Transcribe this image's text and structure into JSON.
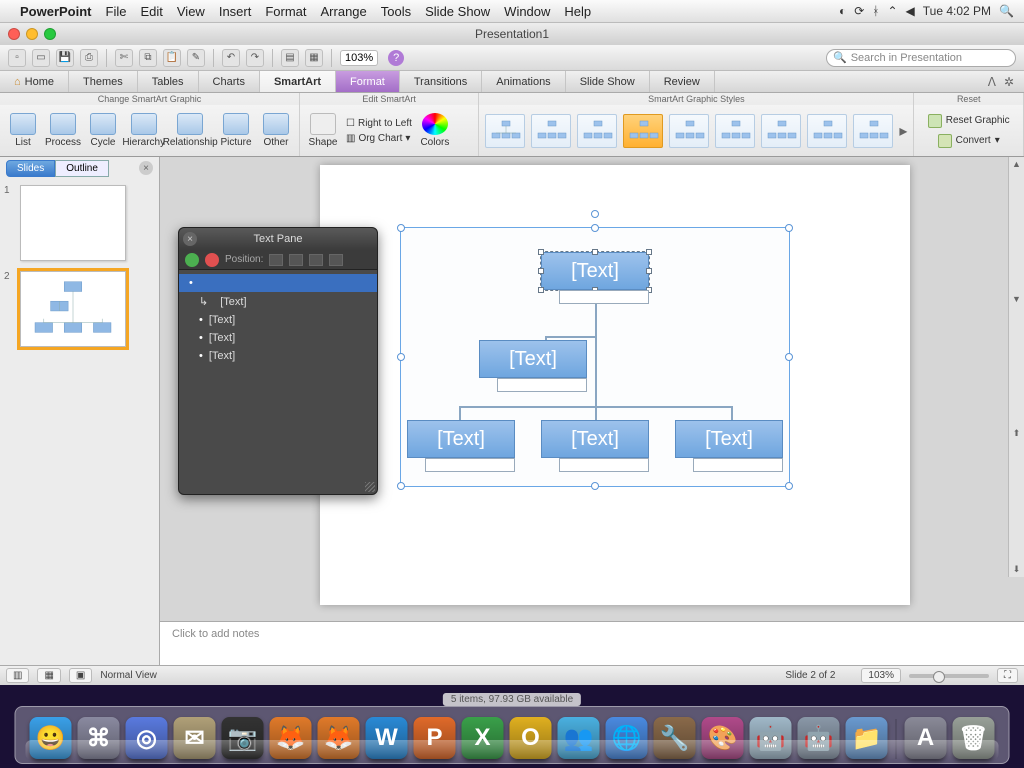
{
  "menubar": {
    "app": "PowerPoint",
    "items": [
      "File",
      "Edit",
      "View",
      "Insert",
      "Format",
      "Arrange",
      "Tools",
      "Slide Show",
      "Window",
      "Help"
    ],
    "clock": "Tue 4:02 PM"
  },
  "window": {
    "title": "Presentation1"
  },
  "qbar": {
    "zoom": "103%"
  },
  "search": {
    "placeholder": "Search in Presentation"
  },
  "ribbon_tabs": [
    "Home",
    "Themes",
    "Tables",
    "Charts",
    "SmartArt",
    "Format",
    "Transitions",
    "Animations",
    "Slide Show",
    "Review"
  ],
  "ribbon": {
    "change_group": "Change SmartArt Graphic",
    "change_btns": [
      "List",
      "Process",
      "Cycle",
      "Hierarchy",
      "Relationship",
      "Picture",
      "Other"
    ],
    "edit_group": "Edit SmartArt",
    "shape_btn": "Shape",
    "rtl": "Right to Left",
    "orgchart": "Org Chart",
    "colors_btn": "Colors",
    "styles_group": "SmartArt Graphic Styles",
    "reset_group": "Reset",
    "reset_btn": "Reset Graphic",
    "convert_btn": "Convert"
  },
  "slides_panel": {
    "tab_slides": "Slides",
    "tab_outline": "Outline",
    "slides": [
      {
        "n": "1"
      },
      {
        "n": "2"
      }
    ]
  },
  "textpane": {
    "title": "Text Pane",
    "position_lbl": "Position:",
    "items": [
      "",
      "[Text]",
      "[Text]",
      "[Text]",
      "[Text]"
    ]
  },
  "smartart": {
    "placeholder": "[Text]"
  },
  "notes": {
    "placeholder": "Click to add notes"
  },
  "statusbar": {
    "view": "Normal View",
    "slide": "Slide 2 of 2",
    "zoom": "103%"
  },
  "finder_status": "5 items, 97.93 GB available",
  "dock_letters": [
    {
      "t": "😀",
      "c": "#3aa0e8"
    },
    {
      "t": "⌘",
      "c": "#8a8aa0"
    },
    {
      "t": "◎",
      "c": "#5a7adf"
    },
    {
      "t": "✉",
      "c": "#b0a078"
    },
    {
      "t": "📷",
      "c": "#333"
    },
    {
      "t": "🦊",
      "c": "#e07a2a"
    },
    {
      "t": "🦊",
      "c": "#e07a2a"
    },
    {
      "t": "W",
      "c": "#2a8ad6"
    },
    {
      "t": "P",
      "c": "#e06a2a"
    },
    {
      "t": "X",
      "c": "#3aa04a"
    },
    {
      "t": "O",
      "c": "#e0b020"
    },
    {
      "t": "👥",
      "c": "#4ab0e0"
    },
    {
      "t": "🌐",
      "c": "#4a8ae0"
    },
    {
      "t": "🔧",
      "c": "#8a6a4a"
    },
    {
      "t": "🎨",
      "c": "#b04a8a"
    },
    {
      "t": "🤖",
      "c": "#a0b8c8"
    },
    {
      "t": "🤖",
      "c": "#8a98a8"
    },
    {
      "t": "📁",
      "c": "#6a9ad0"
    },
    {
      "t": "A",
      "c": "#8a8a98"
    },
    {
      "t": "🗑",
      "c": "#98a098"
    }
  ]
}
